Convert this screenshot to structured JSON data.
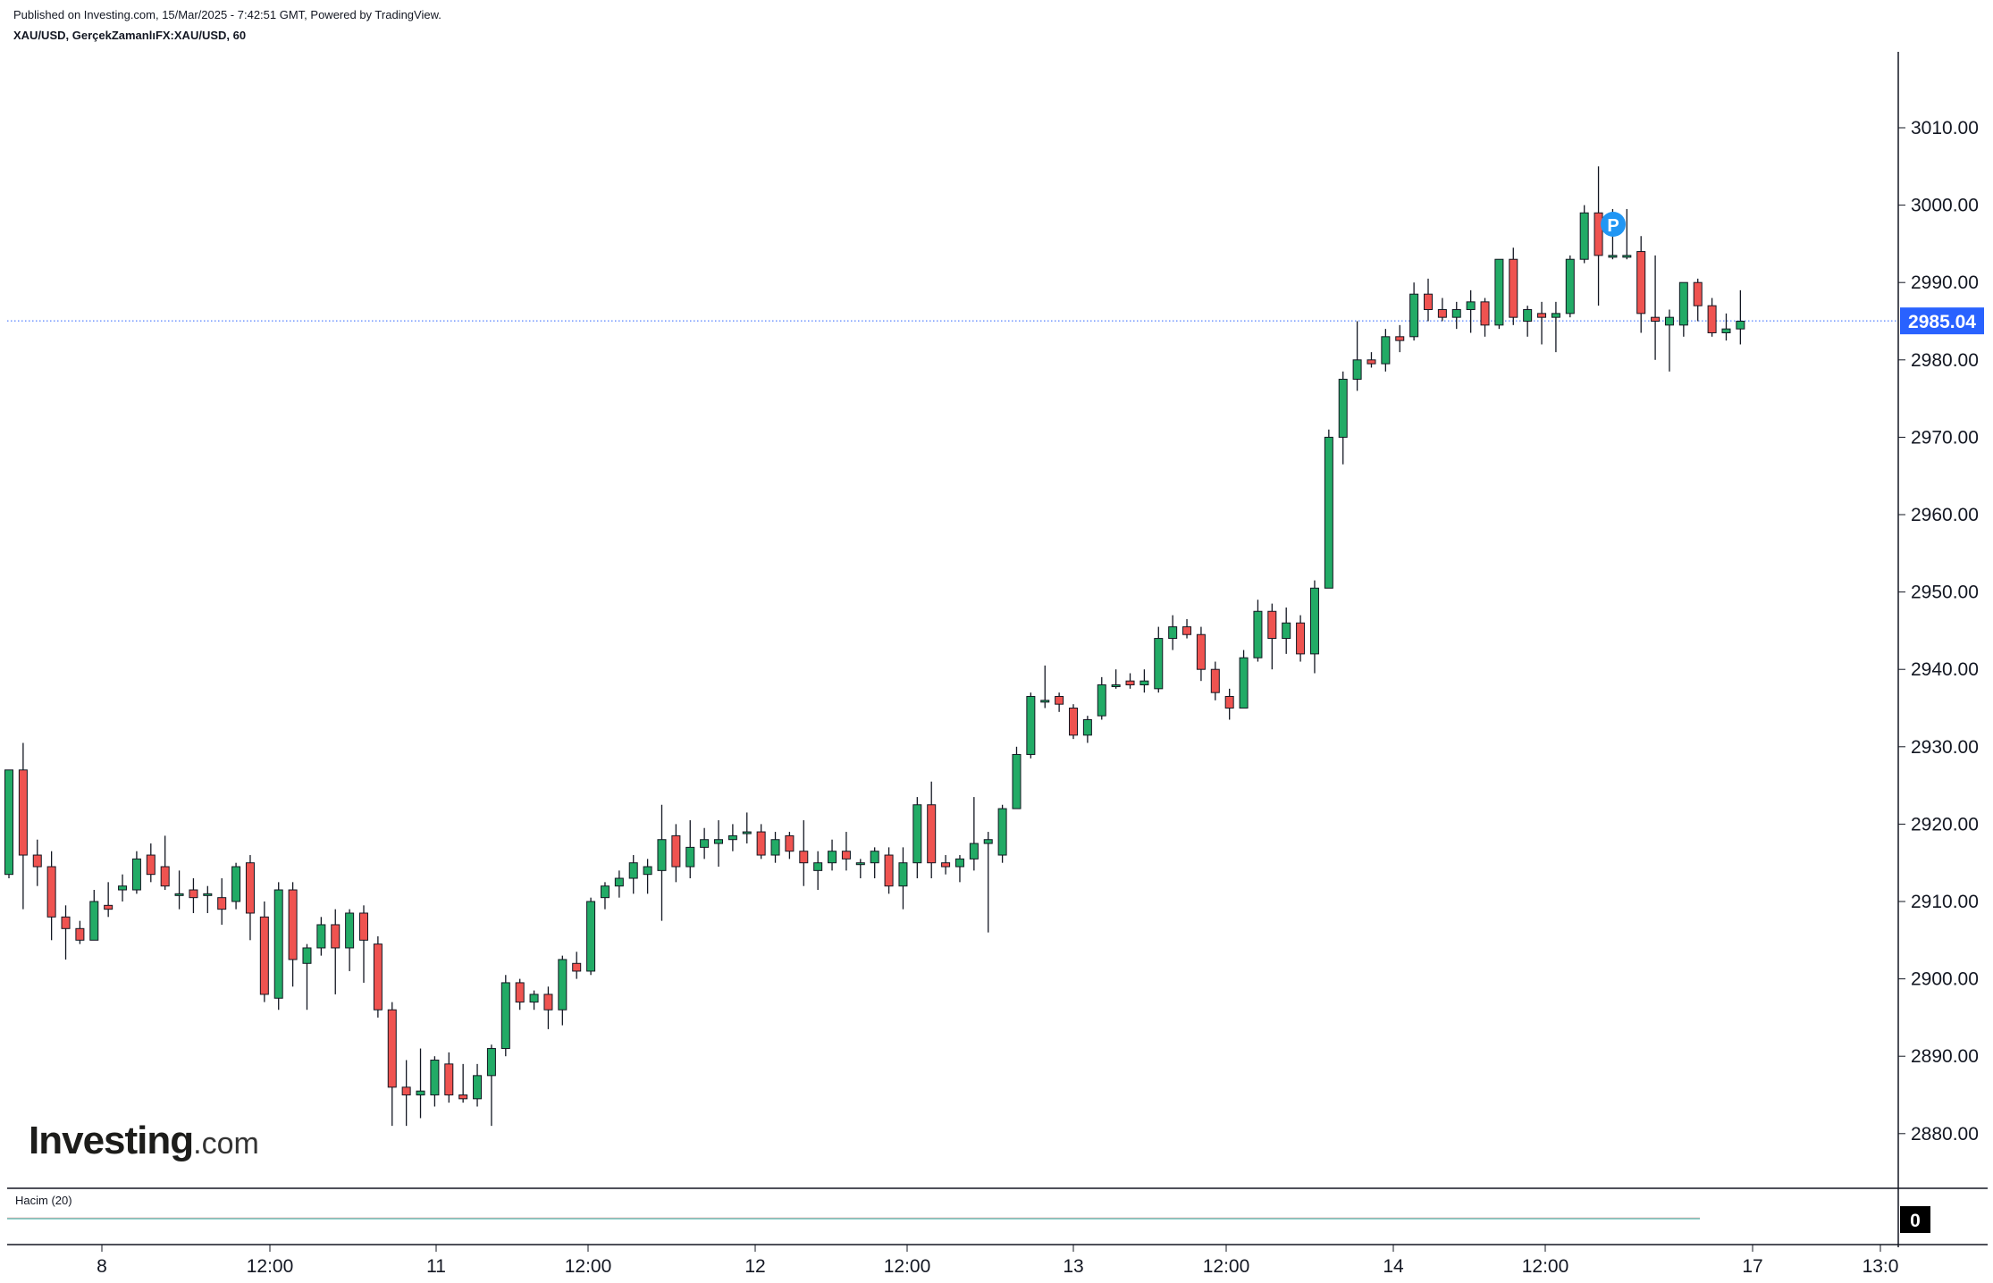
{
  "header": {
    "published": "Published on Investing.com, 15/Mar/2025 - 7:42:51 GMT, Powered by TradingView.",
    "symbol_line": "XAU/USD, GerçekZamanlıFX:XAU/USD, 60"
  },
  "logo": {
    "brand": "Investing",
    "suffix": ".com"
  },
  "volume_panel": {
    "label": "Hacim (20)",
    "value_badge": "0"
  },
  "price_marker": {
    "label": "P"
  },
  "chart_data": {
    "type": "candlestick",
    "symbol": "XAU/USD",
    "interval_minutes": 60,
    "ylim": [
      2872,
      3022
    ],
    "y_ticks": [
      2880,
      2890,
      2900,
      2910,
      2920,
      2930,
      2940,
      2950,
      2960,
      2970,
      2980,
      2990,
      3000,
      3010
    ],
    "y_tick_labels": [
      "2880.00",
      "2890.00",
      "2900.00",
      "2910.00",
      "2920.00",
      "2930.00",
      "2940.00",
      "2950.00",
      "2960.00",
      "2970.00",
      "2980.00",
      "2990.00",
      "3000.00",
      "3010.00"
    ],
    "x_tick_labels": [
      "8",
      "12:00",
      "11",
      "12:00",
      "12",
      "12:00",
      "13",
      "12:00",
      "14",
      "12:00",
      "17",
      "13:0"
    ],
    "last_price": 2985.04,
    "last_price_label": "2985.04",
    "colors": {
      "up": "#22ab66",
      "down": "#ef5350",
      "wick": "#131722",
      "last_price": "#2962ff",
      "marker": "#2196f3"
    },
    "candles": [
      [
        2913.5,
        2927.0,
        2913.0,
        2927.0
      ],
      [
        2927.0,
        2930.5,
        2909.0,
        2916.0
      ],
      [
        2916.0,
        2918.0,
        2912.0,
        2914.5
      ],
      [
        2914.5,
        2916.5,
        2905.0,
        2908.0
      ],
      [
        2908.0,
        2909.5,
        2902.5,
        2906.5
      ],
      [
        2906.5,
        2907.5,
        2904.5,
        2905.0
      ],
      [
        2905.0,
        2911.5,
        2905.0,
        2910.0
      ],
      [
        2909.5,
        2912.5,
        2908.0,
        2909.0
      ],
      [
        2911.5,
        2913.5,
        2910.0,
        2912.0
      ],
      [
        2911.5,
        2916.5,
        2911.0,
        2915.5
      ],
      [
        2916.0,
        2917.5,
        2912.5,
        2913.5
      ],
      [
        2914.5,
        2918.5,
        2911.5,
        2912.0
      ],
      [
        2911.0,
        2914.0,
        2909.0,
        2911.0
      ],
      [
        2911.5,
        2913.0,
        2908.5,
        2910.5
      ],
      [
        2911.0,
        2912.0,
        2908.5,
        2911.0
      ],
      [
        2910.5,
        2913.0,
        2907.0,
        2909.0
      ],
      [
        2910.0,
        2915.0,
        2909.0,
        2914.5
      ],
      [
        2915.0,
        2916.0,
        2905.0,
        2908.5
      ],
      [
        2908.0,
        2910.0,
        2897.0,
        2898.0
      ],
      [
        2897.5,
        2912.5,
        2896.0,
        2911.5
      ],
      [
        2911.5,
        2912.5,
        2899.0,
        2902.5
      ],
      [
        2902.0,
        2904.5,
        2896.0,
        2904.0
      ],
      [
        2904.0,
        2908.0,
        2903.0,
        2907.0
      ],
      [
        2907.0,
        2909.0,
        2898.0,
        2904.0
      ],
      [
        2904.0,
        2909.0,
        2901.0,
        2908.5
      ],
      [
        2908.5,
        2909.5,
        2899.5,
        2905.0
      ],
      [
        2904.5,
        2905.5,
        2895.0,
        2896.0
      ],
      [
        2896.0,
        2897.0,
        2881.0,
        2886.0
      ],
      [
        2886.0,
        2889.5,
        2881.0,
        2885.0
      ],
      [
        2885.0,
        2891.0,
        2882.0,
        2885.5
      ],
      [
        2885.0,
        2890.0,
        2883.5,
        2889.5
      ],
      [
        2889.0,
        2890.5,
        2884.0,
        2885.0
      ],
      [
        2885.0,
        2889.0,
        2884.0,
        2884.5
      ],
      [
        2884.5,
        2889.0,
        2883.5,
        2887.5
      ],
      [
        2887.5,
        2891.5,
        2881.0,
        2891.0
      ],
      [
        2891.0,
        2900.5,
        2890.0,
        2899.5
      ],
      [
        2899.5,
        2900.0,
        2896.0,
        2897.0
      ],
      [
        2897.0,
        2898.5,
        2896.0,
        2898.0
      ],
      [
        2898.0,
        2899.0,
        2893.5,
        2896.0
      ],
      [
        2896.0,
        2903.0,
        2894.0,
        2902.5
      ],
      [
        2902.0,
        2903.5,
        2900.0,
        2901.0
      ],
      [
        2901.0,
        2910.5,
        2900.5,
        2910.0
      ],
      [
        2910.5,
        2912.5,
        2909.0,
        2912.0
      ],
      [
        2912.0,
        2914.0,
        2910.5,
        2913.0
      ],
      [
        2913.0,
        2916.0,
        2911.0,
        2915.0
      ],
      [
        2913.5,
        2915.5,
        2911.0,
        2914.5
      ],
      [
        2914.0,
        2922.5,
        2907.5,
        2918.0
      ],
      [
        2918.5,
        2920.0,
        2912.5,
        2914.5
      ],
      [
        2914.5,
        2920.5,
        2913.0,
        2917.0
      ],
      [
        2917.0,
        2919.5,
        2915.5,
        2918.0
      ],
      [
        2917.5,
        2920.5,
        2914.5,
        2918.0
      ],
      [
        2918.0,
        2920.0,
        2916.5,
        2918.5
      ],
      [
        2919.0,
        2921.5,
        2917.5,
        2919.0
      ],
      [
        2919.0,
        2920.0,
        2915.5,
        2916.0
      ],
      [
        2916.0,
        2919.0,
        2915.0,
        2918.0
      ],
      [
        2918.5,
        2919.0,
        2915.5,
        2916.5
      ],
      [
        2916.5,
        2920.5,
        2912.0,
        2915.0
      ],
      [
        2914.0,
        2916.5,
        2911.5,
        2915.0
      ],
      [
        2915.0,
        2918.0,
        2914.0,
        2916.5
      ],
      [
        2916.5,
        2919.0,
        2914.0,
        2915.5
      ],
      [
        2915.0,
        2915.5,
        2913.0,
        2915.0
      ],
      [
        2915.0,
        2917.0,
        2913.0,
        2916.5
      ],
      [
        2916.0,
        2917.0,
        2911.0,
        2912.0
      ],
      [
        2912.0,
        2917.0,
        2909.0,
        2915.0
      ],
      [
        2915.0,
        2923.5,
        2913.0,
        2922.5
      ],
      [
        2922.5,
        2925.5,
        2913.0,
        2915.0
      ],
      [
        2915.0,
        2916.0,
        2913.5,
        2914.5
      ],
      [
        2914.5,
        2916.0,
        2912.5,
        2915.5
      ],
      [
        2915.5,
        2923.5,
        2914.0,
        2917.5
      ],
      [
        2917.5,
        2919.0,
        2906.0,
        2918.0
      ],
      [
        2916.0,
        2922.5,
        2915.0,
        2922.0
      ],
      [
        2922.0,
        2930.0,
        2922.0,
        2929.0
      ],
      [
        2929.0,
        2937.0,
        2928.5,
        2936.5
      ],
      [
        2936.0,
        2940.5,
        2935.0,
        2936.0
      ],
      [
        2936.5,
        2937.0,
        2934.5,
        2935.5
      ],
      [
        2935.0,
        2935.5,
        2931.0,
        2931.5
      ],
      [
        2931.5,
        2934.0,
        2930.5,
        2933.5
      ],
      [
        2934.0,
        2939.0,
        2933.5,
        2938.0
      ],
      [
        2938.0,
        2940.0,
        2937.5,
        2938.0
      ],
      [
        2938.5,
        2939.5,
        2937.5,
        2938.0
      ],
      [
        2938.0,
        2940.0,
        2937.0,
        2938.5
      ],
      [
        2937.5,
        2945.5,
        2937.0,
        2944.0
      ],
      [
        2944.0,
        2947.0,
        2942.5,
        2945.5
      ],
      [
        2945.5,
        2946.5,
        2944.0,
        2944.5
      ],
      [
        2944.5,
        2945.5,
        2938.5,
        2940.0
      ],
      [
        2940.0,
        2941.0,
        2936.0,
        2937.0
      ],
      [
        2936.5,
        2937.5,
        2933.5,
        2935.0
      ],
      [
        2935.0,
        2942.5,
        2935.0,
        2941.5
      ],
      [
        2941.5,
        2949.0,
        2941.0,
        2947.5
      ],
      [
        2947.5,
        2948.5,
        2940.0,
        2944.0
      ],
      [
        2944.0,
        2948.0,
        2942.0,
        2946.0
      ],
      [
        2946.0,
        2947.0,
        2941.0,
        2942.0
      ],
      [
        2942.0,
        2951.5,
        2939.5,
        2950.5
      ],
      [
        2950.5,
        2971.0,
        2950.5,
        2970.0
      ],
      [
        2970.0,
        2978.5,
        2966.5,
        2977.5
      ],
      [
        2977.5,
        2985.0,
        2976.0,
        2980.0
      ],
      [
        2980.0,
        2981.0,
        2979.0,
        2979.5
      ],
      [
        2979.5,
        2984.0,
        2978.5,
        2983.0
      ],
      [
        2983.0,
        2984.5,
        2981.0,
        2982.5
      ],
      [
        2983.0,
        2990.0,
        2982.5,
        2988.5
      ],
      [
        2988.5,
        2990.5,
        2985.0,
        2986.5
      ],
      [
        2986.5,
        2988.0,
        2985.0,
        2985.5
      ],
      [
        2985.5,
        2987.5,
        2984.0,
        2986.5
      ],
      [
        2986.5,
        2989.0,
        2983.5,
        2987.5
      ],
      [
        2987.5,
        2988.0,
        2983.0,
        2984.5
      ],
      [
        2984.5,
        2993.0,
        2984.0,
        2993.0
      ],
      [
        2993.0,
        2994.5,
        2984.5,
        2985.5
      ],
      [
        2985.0,
        2987.0,
        2983.0,
        2986.5
      ],
      [
        2986.0,
        2987.5,
        2982.0,
        2985.5
      ],
      [
        2985.5,
        2987.5,
        2981.0,
        2986.0
      ],
      [
        2986.0,
        2993.5,
        2985.5,
        2993.0
      ],
      [
        2993.0,
        3000.0,
        2992.5,
        2999.0
      ],
      [
        2999.0,
        3005.0,
        2987.0,
        2993.5
      ],
      [
        2993.5,
        2999.5,
        2993.0,
        2993.5
      ],
      [
        2993.5,
        2999.5,
        2993.0,
        2993.5
      ],
      [
        2994.0,
        2996.0,
        2983.5,
        2986.0
      ],
      [
        2985.5,
        2993.5,
        2980.0,
        2985.0
      ],
      [
        2984.5,
        2986.5,
        2978.5,
        2985.5
      ],
      [
        2984.5,
        2990.0,
        2983.0,
        2990.0
      ],
      [
        2990.0,
        2990.5,
        2985.0,
        2987.0
      ],
      [
        2987.0,
        2988.0,
        2983.0,
        2983.5
      ],
      [
        2983.5,
        2986.0,
        2982.5,
        2984.0
      ],
      [
        2984.0,
        2989.0,
        2982.0,
        2985.0
      ]
    ]
  }
}
